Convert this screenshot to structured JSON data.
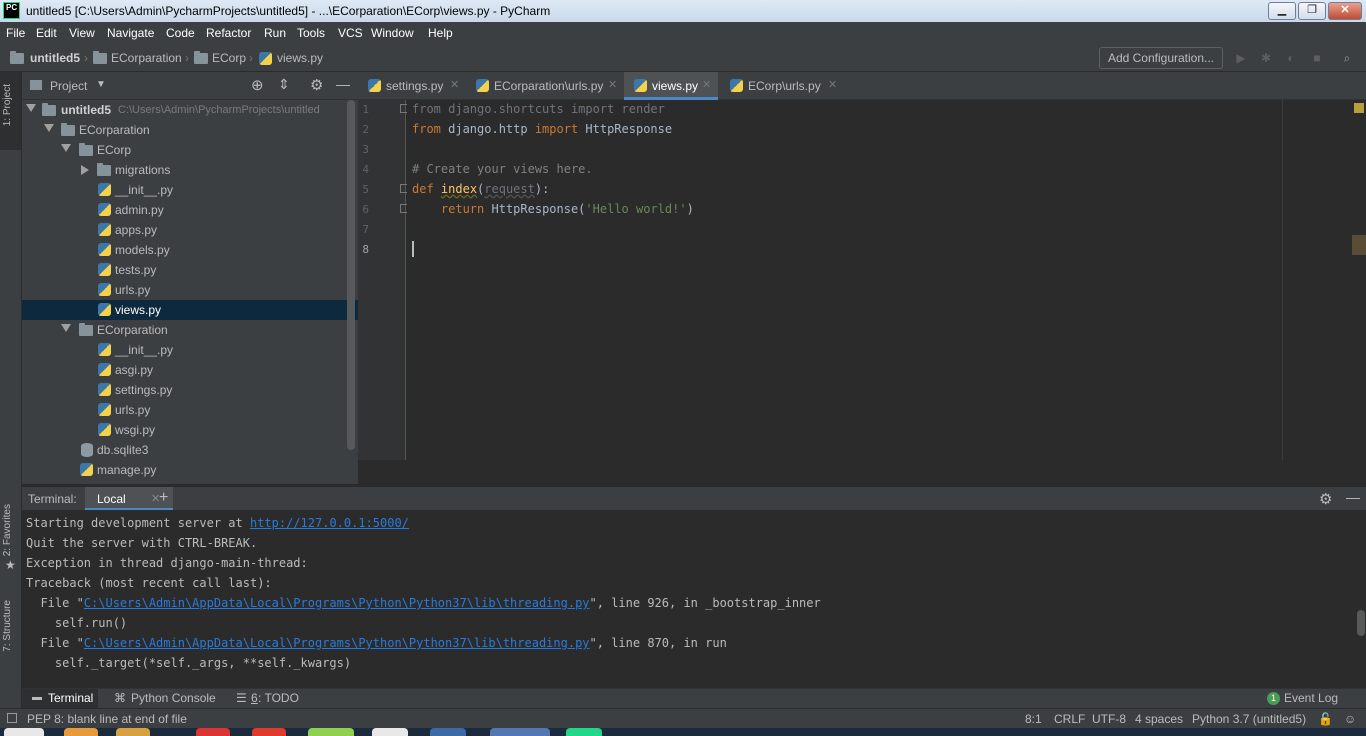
{
  "window": {
    "title": "untitled5 [C:\\Users\\Admin\\PycharmProjects\\untitled5] - ...\\ECorparation\\ECorp\\views.py - PyCharm",
    "logo_text": "PC",
    "min": "▁",
    "max": "❐",
    "close": "✕"
  },
  "menu": [
    "File",
    "Edit",
    "View",
    "Navigate",
    "Code",
    "Refactor",
    "Run",
    "Tools",
    "VCS",
    "Window",
    "Help"
  ],
  "breadcrumb": [
    "untitled5",
    "ECorparation",
    "ECorp",
    "views.py"
  ],
  "toolbar": {
    "add_config": "Add Configuration..."
  },
  "left_strip": {
    "project": "1: Project",
    "favorites": "2: Favorites",
    "structure": "7: Structure"
  },
  "project": {
    "header": "Project",
    "tree": [
      {
        "label": "untitled5",
        "path": "C:\\Users\\Admin\\PycharmProjects\\untitled"
      },
      {
        "label": "ECorparation"
      },
      {
        "label": "ECorp"
      },
      {
        "label": "migrations"
      },
      {
        "label": "__init__.py"
      },
      {
        "label": "admin.py"
      },
      {
        "label": "apps.py"
      },
      {
        "label": "models.py"
      },
      {
        "label": "tests.py"
      },
      {
        "label": "urls.py"
      },
      {
        "label": "views.py"
      },
      {
        "label": "ECorparation"
      },
      {
        "label": "__init__.py"
      },
      {
        "label": "asgi.py"
      },
      {
        "label": "settings.py"
      },
      {
        "label": "urls.py"
      },
      {
        "label": "wsgi.py"
      },
      {
        "label": "db.sqlite3"
      },
      {
        "label": "manage.py"
      }
    ]
  },
  "editor": {
    "tabs": [
      "settings.py",
      "ECorparation\\urls.py",
      "views.py",
      "ECorp\\urls.py"
    ],
    "active_tab": "views.py",
    "line_numbers": [
      "1",
      "2",
      "3",
      "4",
      "5",
      "6",
      "7",
      "8"
    ],
    "code": {
      "l1": "from django.shortcuts import render",
      "l2_kw1": "from",
      "l2_mod": " django.http ",
      "l2_kw2": "import",
      "l2_name": " HttpResponse",
      "l4": "# Create your views here.",
      "l5_kw": "def",
      "l5_fn": "index",
      "l5_open": "(",
      "l5_param": "request",
      "l5_close": "):",
      "l6_kw": "return",
      "l6_call": " HttpResponse(",
      "l6_str": "'Hello world!'",
      "l6_end": ")"
    }
  },
  "terminal": {
    "label": "Terminal:",
    "tab": "Local",
    "lines": {
      "t1_pre": "Starting development server at ",
      "t1_link": "http://127.0.0.1:5000/",
      "t2": "Quit the server with CTRL-BREAK.",
      "t3": "Exception in thread django-main-thread:",
      "t4": "Traceback (most recent call last):",
      "t5_pre": "  File \"",
      "t5_link": "C:\\Users\\Admin\\AppData\\Local\\Programs\\Python\\Python37\\lib\\threading.py",
      "t5_post": "\", line 926, in _bootstrap_inner",
      "t6": "    self.run()",
      "t7_pre": "  File \"",
      "t7_link": "C:\\Users\\Admin\\AppData\\Local\\Programs\\Python\\Python37\\lib\\threading.py",
      "t7_post": "\", line 870, in run",
      "t8": "    self._target(*self._args, **self._kwargs)"
    }
  },
  "bottom_tabs": {
    "terminal": "Terminal",
    "python_console": "Python Console",
    "todo_num": "6",
    "todo": ": TODO",
    "event_log": "Event Log",
    "event_count": "1"
  },
  "status": {
    "message": "PEP 8: blank line at end of file",
    "position": "8:1",
    "line_sep": "CRLF",
    "encoding": "UTF-8",
    "indent": "4 spaces",
    "interpreter": "Python 3.7 (untitled5)"
  },
  "colors": {
    "accent": "#4a88c7",
    "selection": "#0d293e",
    "bg_editor": "#2b2b2b",
    "bg_panel": "#3c3f41",
    "keyword": "#cc7832",
    "string": "#6a8759",
    "function": "#ffc66d",
    "link": "#287bde"
  }
}
